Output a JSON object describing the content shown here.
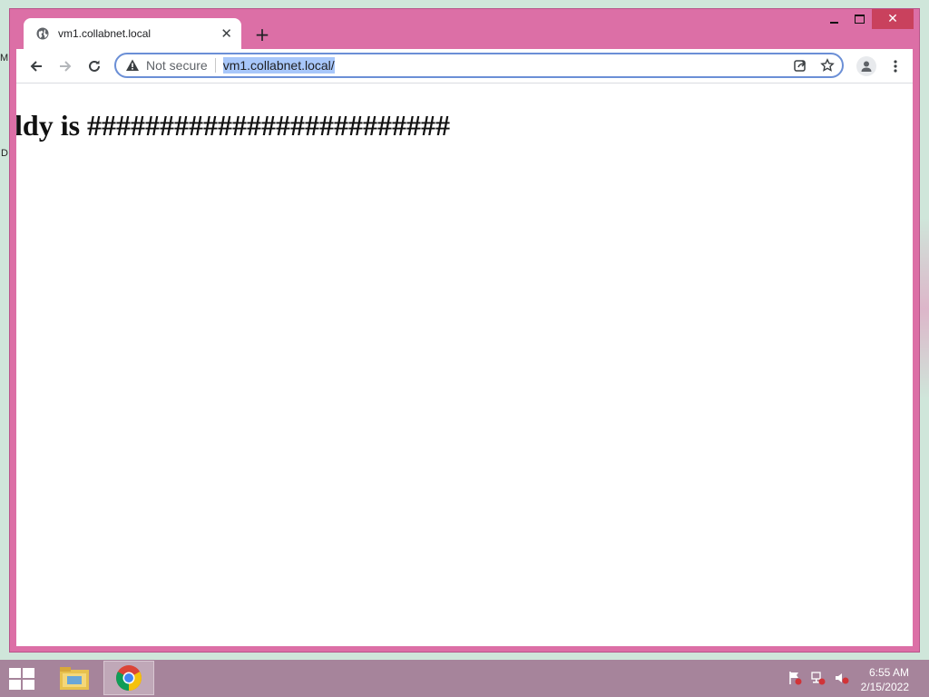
{
  "desktop": {
    "fragments": [
      "M",
      "D"
    ]
  },
  "window": {
    "controls": {
      "minimize": "minimize",
      "maximize": "maximize",
      "close": "✕"
    },
    "accent_color": "#dc6fa6"
  },
  "tab": {
    "title": "vm1.collabnet.local",
    "close_label": "✕",
    "favicon": "globe-icon"
  },
  "new_tab_label": "+",
  "toolbar": {
    "back": "arrow-left-icon",
    "forward": "arrow-right-icon",
    "reload": "reload-icon"
  },
  "omnibox": {
    "security_text": "Not secure",
    "url": "vm1.collabnet.local/",
    "selection_color": "#a8c7fa"
  },
  "page": {
    "heading": "ldy is #########################"
  },
  "taskbar": {
    "apps": [
      "file-explorer-icon",
      "chrome-icon"
    ],
    "clock": {
      "time": "6:55 AM",
      "date": "2/15/2022"
    }
  }
}
